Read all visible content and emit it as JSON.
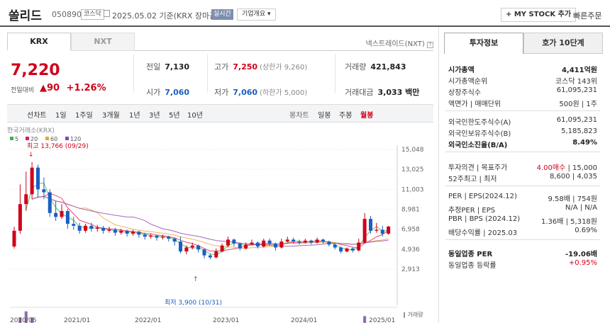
{
  "header": {
    "name": "쏠리드",
    "code": "050890",
    "market_badge": "코스닥",
    "date": "2025.05.02 기준(KRX 장마감)",
    "live_badge": "실시간",
    "company_menu": "기업개요 ▾",
    "mystock_button": "+ MY STOCK 추가",
    "quick_order": "빠른주문"
  },
  "exchange_tabs": [
    "KRX",
    "NXT"
  ],
  "nxt_link": "넥스트레이드(NXT)",
  "price": {
    "current": "7,220",
    "change_label": "전일대비",
    "change": "▲90",
    "change_pct": "+1.26%"
  },
  "stats": {
    "prev_close_label": "전일",
    "prev_close": "7,130",
    "high_label": "고가",
    "high": "7,250",
    "high_limit": "(상한가 9,260)",
    "volume_label": "거래량",
    "volume": "421,843",
    "open_label": "시가",
    "open": "7,060",
    "low_label": "저가",
    "low": "7,060",
    "low_limit": "(하한가 5,000)",
    "amount_label": "거래대금",
    "amount": "3,033 백만"
  },
  "period_tabs": [
    "선차트",
    "1일",
    "1주일",
    "3개월",
    "1년",
    "3년",
    "5년",
    "10년"
  ],
  "candle_tabs": [
    "봉차트",
    "일봉",
    "주봉",
    "월봉"
  ],
  "chart_data": {
    "type": "candlestick",
    "source_label": "한국거래소(KRX)",
    "ma_legend": [
      {
        "name": "5",
        "color": "#3cb44b"
      },
      {
        "name": "20",
        "color": "#e6194b"
      },
      {
        "name": "60",
        "color": "#e6a23c"
      },
      {
        "name": "120",
        "color": "#8e44ad"
      }
    ],
    "y_ticks": [
      "15,048",
      "13,025",
      "11,003",
      "8,981",
      "6,958",
      "4,936",
      "2,913"
    ],
    "y_tick_values": [
      15048,
      13025,
      11003,
      8981,
      6958,
      4936,
      2913
    ],
    "x_ticks": [
      "2020/06",
      "2021/01",
      "2022/01",
      "2023/01",
      "2024/01",
      "2025/01"
    ],
    "max_label": "최고 13,766 (09/29)",
    "min_label": "최저 3,900 (10/31)",
    "volume_label": "거래량",
    "up_color": "#d0021b",
    "down_color": "#1a5fc1",
    "candles": [
      {
        "o": 5200,
        "c": 6800,
        "h": 7200,
        "l": 5000
      },
      {
        "o": 6800,
        "c": 9500,
        "h": 11500,
        "l": 6500
      },
      {
        "o": 9500,
        "c": 10500,
        "h": 12800,
        "l": 8800
      },
      {
        "o": 10500,
        "c": 13200,
        "h": 13766,
        "l": 10000
      },
      {
        "o": 13200,
        "c": 11000,
        "h": 13500,
        "l": 10200
      },
      {
        "o": 11000,
        "c": 10700,
        "h": 12200,
        "l": 10000
      },
      {
        "o": 10700,
        "c": 8600,
        "h": 11000,
        "l": 8200
      },
      {
        "o": 8600,
        "c": 8200,
        "h": 9800,
        "l": 7800
      },
      {
        "o": 8200,
        "c": 8800,
        "h": 9500,
        "l": 8000
      },
      {
        "o": 8800,
        "c": 7500,
        "h": 9000,
        "l": 7000
      },
      {
        "o": 7500,
        "c": 7300,
        "h": 8200,
        "l": 6900
      },
      {
        "o": 7300,
        "c": 6800,
        "h": 7600,
        "l": 6500
      },
      {
        "o": 6800,
        "c": 7300,
        "h": 7500,
        "l": 6600
      },
      {
        "o": 7300,
        "c": 7000,
        "h": 7600,
        "l": 6700
      },
      {
        "o": 7000,
        "c": 7100,
        "h": 7400,
        "l": 6700
      },
      {
        "o": 7100,
        "c": 6800,
        "h": 7300,
        "l": 6500
      },
      {
        "o": 6800,
        "c": 6900,
        "h": 7200,
        "l": 6600
      },
      {
        "o": 6900,
        "c": 6600,
        "h": 7100,
        "l": 6300
      },
      {
        "o": 6600,
        "c": 6800,
        "h": 7000,
        "l": 6400
      },
      {
        "o": 6800,
        "c": 6500,
        "h": 6900,
        "l": 6200
      },
      {
        "o": 6500,
        "c": 6700,
        "h": 6900,
        "l": 6300
      },
      {
        "o": 6700,
        "c": 6400,
        "h": 6800,
        "l": 6100
      },
      {
        "o": 6400,
        "c": 6200,
        "h": 6600,
        "l": 5900
      },
      {
        "o": 6200,
        "c": 6300,
        "h": 6500,
        "l": 6000
      },
      {
        "o": 6300,
        "c": 6100,
        "h": 6400,
        "l": 5800
      },
      {
        "o": 6100,
        "c": 6200,
        "h": 6400,
        "l": 5900
      },
      {
        "o": 6200,
        "c": 6000,
        "h": 6300,
        "l": 5700
      },
      {
        "o": 6000,
        "c": 5700,
        "h": 6100,
        "l": 5300
      },
      {
        "o": 5700,
        "c": 4700,
        "h": 6200,
        "l": 4500
      },
      {
        "o": 4700,
        "c": 5100,
        "h": 5300,
        "l": 4400
      },
      {
        "o": 5100,
        "c": 5300,
        "h": 5600,
        "l": 4900
      },
      {
        "o": 5300,
        "c": 4900,
        "h": 5400,
        "l": 4600
      },
      {
        "o": 4900,
        "c": 4300,
        "h": 5000,
        "l": 4000
      },
      {
        "o": 4300,
        "c": 4100,
        "h": 4500,
        "l": 3900
      },
      {
        "o": 4100,
        "c": 4700,
        "h": 5000,
        "l": 4000
      },
      {
        "o": 4700,
        "c": 5300,
        "h": 5500,
        "l": 4600
      },
      {
        "o": 5300,
        "c": 5900,
        "h": 6200,
        "l": 5100
      },
      {
        "o": 5900,
        "c": 5500,
        "h": 6000,
        "l": 5200
      },
      {
        "o": 5500,
        "c": 5000,
        "h": 5600,
        "l": 4800
      },
      {
        "o": 5000,
        "c": 5400,
        "h": 5600,
        "l": 4900
      },
      {
        "o": 5400,
        "c": 5600,
        "h": 5900,
        "l": 5300
      },
      {
        "o": 5600,
        "c": 5200,
        "h": 5700,
        "l": 5000
      },
      {
        "o": 5200,
        "c": 5800,
        "h": 6000,
        "l": 5100
      },
      {
        "o": 5800,
        "c": 5500,
        "h": 6000,
        "l": 5300
      },
      {
        "o": 5500,
        "c": 5100,
        "h": 5600,
        "l": 4800
      },
      {
        "o": 5100,
        "c": 5700,
        "h": 6000,
        "l": 5000
      },
      {
        "o": 5700,
        "c": 5900,
        "h": 6200,
        "l": 5600
      },
      {
        "o": 5900,
        "c": 5700,
        "h": 6100,
        "l": 5500
      },
      {
        "o": 5700,
        "c": 5600,
        "h": 5900,
        "l": 5400
      },
      {
        "o": 5600,
        "c": 5800,
        "h": 6000,
        "l": 5500
      },
      {
        "o": 5800,
        "c": 5600,
        "h": 5900,
        "l": 5400
      },
      {
        "o": 5600,
        "c": 5900,
        "h": 6100,
        "l": 5500
      },
      {
        "o": 5900,
        "c": 5700,
        "h": 6000,
        "l": 5500
      },
      {
        "o": 5700,
        "c": 5400,
        "h": 5800,
        "l": 5200
      },
      {
        "o": 5400,
        "c": 5100,
        "h": 5500,
        "l": 4900
      },
      {
        "o": 5100,
        "c": 4700,
        "h": 5200,
        "l": 4500
      },
      {
        "o": 4700,
        "c": 5000,
        "h": 5100,
        "l": 4600
      },
      {
        "o": 5000,
        "c": 4800,
        "h": 5100,
        "l": 4600
      },
      {
        "o": 4800,
        "c": 5600,
        "h": 6000,
        "l": 4700
      },
      {
        "o": 5600,
        "c": 8000,
        "h": 8600,
        "l": 5500
      },
      {
        "o": 8000,
        "c": 6800,
        "h": 8300,
        "l": 6500
      },
      {
        "o": 6800,
        "c": 6900,
        "h": 7600,
        "l": 6600
      },
      {
        "o": 6900,
        "c": 6500,
        "h": 7300,
        "l": 6200
      },
      {
        "o": 6500,
        "c": 7220,
        "h": 7300,
        "l": 6400
      }
    ],
    "volumes": [
      0.3,
      0.7,
      0.95,
      0.7,
      0.4,
      0.25,
      0.2,
      0.15,
      0.35,
      0.12,
      0.15,
      0.1,
      0.08,
      0.1,
      0.08,
      0.06,
      0.07,
      0.06,
      0.08,
      0.05,
      0.06,
      0.05,
      0.05,
      0.06,
      0.05,
      0.04,
      0.05,
      0.06,
      0.12,
      0.18,
      0.1,
      0.08,
      0.1,
      0.14,
      0.22,
      0.12,
      0.18,
      0.1,
      0.08,
      0.07,
      0.12,
      0.08,
      0.09,
      0.08,
      0.07,
      0.06,
      0.08,
      0.07,
      0.05,
      0.06,
      0.05,
      0.07,
      0.06,
      0.05,
      0.06,
      0.08,
      0.05,
      0.06,
      0.4,
      0.75,
      0.35,
      0.15,
      0.08,
      0.1
    ]
  },
  "right_panel": {
    "tabs": [
      "투자정보",
      "호가 10단계"
    ],
    "group1": [
      {
        "k": "시가총액",
        "v": "4,411억원",
        "bold": true
      },
      {
        "k": "시가총액순위",
        "v": "코스닥 143위"
      },
      {
        "k": "상장주식수",
        "v": "61,095,231"
      },
      {
        "k": "액면가 | 매매단위",
        "v": "500원 | 1주"
      }
    ],
    "group2": [
      {
        "k": "외국인한도주식수(A)",
        "v": "61,095,231"
      },
      {
        "k": "외국인보유주식수(B)",
        "v": "5,185,823"
      },
      {
        "k": "외국인소진율(B/A)",
        "v": "8.49%",
        "bold": true
      }
    ],
    "group3": [
      {
        "k": "투자의견 | 목표주가",
        "v_red": "4.00매수",
        "v": " | 15,000"
      },
      {
        "k": "52주최고 | 최저",
        "v": "8,600 | 4,035"
      }
    ],
    "group4": [
      {
        "k": "PER | EPS(2024.12)",
        "v": "9.58배 | 754원"
      },
      {
        "k": "추정PER | EPS",
        "v": "N/A | N/A"
      },
      {
        "k": "PBR | BPS (2024.12)",
        "v": "1.36배 | 5,318원"
      },
      {
        "k": "배당수익률 | 2025.03",
        "v": "0.69%"
      }
    ],
    "group5": [
      {
        "k": "동일업종 PER",
        "v": "-19.06배",
        "bold": true
      },
      {
        "k": "동일업종 등락률",
        "v": "+0.95%",
        "red": true
      }
    ]
  }
}
